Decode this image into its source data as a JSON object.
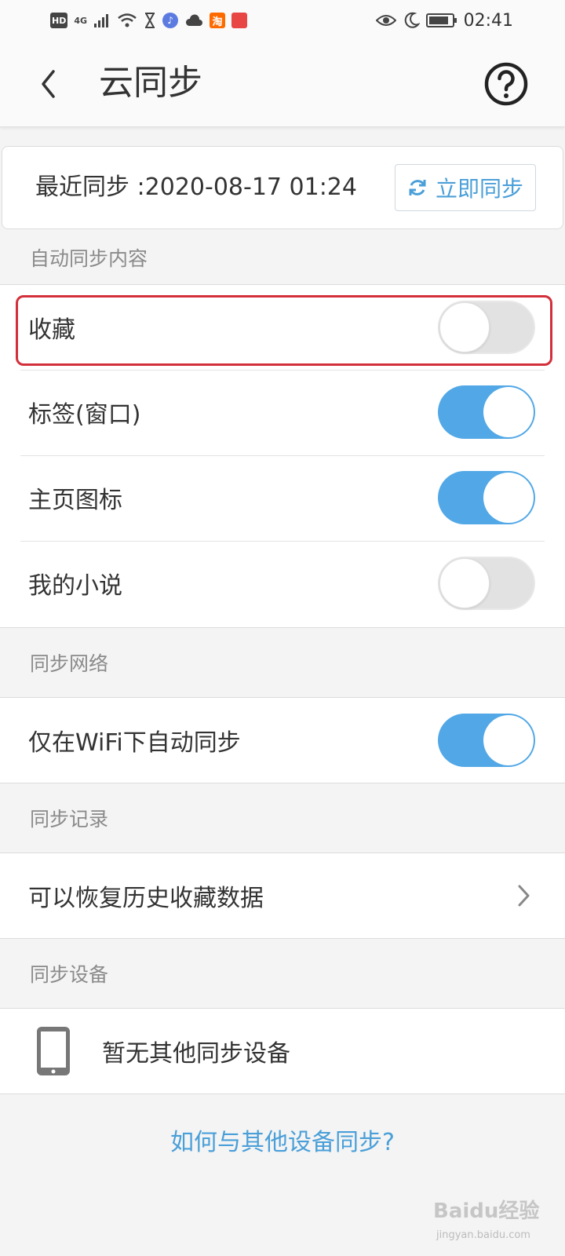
{
  "status_bar": {
    "left_icons": [
      "HD",
      "4G",
      "signal-icon",
      "wifi-icon",
      "hourglass-icon",
      "music-icon",
      "cloud-icon",
      "淘",
      "huawei-app-icon"
    ],
    "hd": "HD",
    "network": "4G",
    "taobao": "淘",
    "time": "02:41"
  },
  "app_bar": {
    "title": "云同步",
    "back_icon": "chevron-left-icon",
    "help_icon": "question-circle-icon"
  },
  "sync_card": {
    "last_sync": "最近同步 :2020-08-17 01:24",
    "sync_now_label": "立即同步",
    "accent": "#4a9fd8"
  },
  "sections": {
    "auto_sync": {
      "header": "自动同步内容",
      "items": [
        {
          "label": "收藏",
          "enabled": false,
          "highlighted": true
        },
        {
          "label": "标签(窗口)",
          "enabled": true
        },
        {
          "label": "主页图标",
          "enabled": true
        },
        {
          "label": "我的小说",
          "enabled": false
        }
      ]
    },
    "network": {
      "header": "同步网络",
      "items": [
        {
          "label": "仅在WiFi下自动同步",
          "enabled": true
        }
      ]
    },
    "records": {
      "header": "同步记录",
      "item_label": "可以恢复历史收藏数据"
    },
    "devices": {
      "header": "同步设备",
      "item_label": "暂无其他同步设备"
    }
  },
  "help_link": "如何与其他设备同步?",
  "watermark": {
    "brand": "Baidu经验",
    "url": "jingyan.baidu.com"
  },
  "colors": {
    "toggle_on": "#52a8e6",
    "toggle_off": "#e2e2e2",
    "highlight": "#d32f3a",
    "link": "#4a9fd8"
  }
}
